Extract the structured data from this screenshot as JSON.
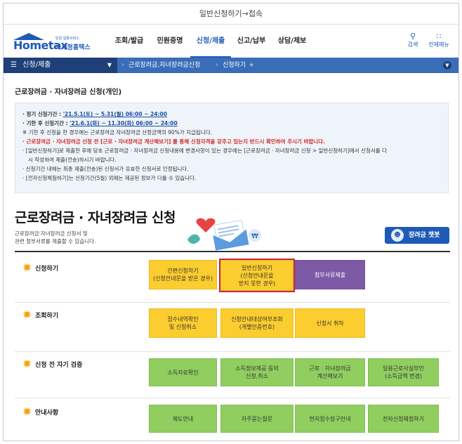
{
  "caption": "일반신청하기→접속",
  "header": {
    "logo_tiny": "민원 일괄서비스",
    "logo_brand": "Hometax",
    "logo_sub": "국세청홈택스",
    "gnb": [
      "조회/발급",
      "민원증명",
      "신청/제출",
      "신고/납부",
      "상담/제보"
    ],
    "active_index": 2,
    "util_search": "검색",
    "util_menu": "전체메뉴"
  },
  "navbar": {
    "menu": "신청/제출",
    "crumb1": "근로장려금,자녀장려금신청",
    "crumb2": "신청하기"
  },
  "page_title": "근로장려금 · 자녀장려금 신청(개인)",
  "notice": {
    "l1_label": "· 정기 신청기간 : ",
    "l1_value": "'21.5.1(토) ~ 5.31(월) 06:00 ~ 24:00",
    "l2_label": "· 기한 후 신청기간 : ",
    "l2_value": "'21.6.1(화) ~ 11.30(화) 06:00 ~ 24:00",
    "l3": "※ 기한 후 신청을 한 경우에는 근로장려금 자녀장려금 산정금액의 90%가 지급됩니다.",
    "l4": "· 근로장려금 · 자녀장려금 신청 전 [근로 · 자녀장려금 계산해보기] 를 통해 신청자격을 갖추고 있는지 반드시 확인하여 주시기 바랍니다.",
    "l5a": "· [일반신청하기]로 제출한 후에 당초 근로장려금 · 자녀장려금 신청내용에 변경사항이 있는 경우에는 [근로장려금 · 자녀장려금 신청 > 일반신청하기]에서 신청서를 다",
    "l5b": "시 작성하여 제출(전송)하시기 바랍니다.",
    "l6": "· 신청기간 내에는 최종 제출(전송)된 신청서가 유효한 신청서로 인정됩니다.",
    "l7": "· [전자신청체험하기]는 신청기간(5월) 외에는 제공된 정보가 다를 수 있습니다."
  },
  "big_title": "근로장려금 · 자녀장려금 신청",
  "desc_1": "근로장려금·자녀장려금 신청서 및",
  "desc_2": "관련 첨부서류를 제출할 수 있습니다.",
  "chatbot_label": "장려금 챗봇",
  "sections": [
    {
      "label": "신청하기",
      "buttons": [
        {
          "l1": "간편신청하기",
          "l2": "(신청안내문을 받은 경우)"
        },
        {
          "l1": "일반신청하기",
          "l2": "(신청안내문을",
          "l3": "받지 못한 경우)"
        },
        {
          "l1": "첨부서류제출"
        }
      ]
    },
    {
      "label": "조회하기",
      "buttons": [
        {
          "l1": "접수내역확인",
          "l2": "및 신청취소"
        },
        {
          "l1": "신청안내대상여부조회",
          "l2": "(개별인증번호)"
        },
        {
          "l1": "신청서 취하"
        }
      ]
    },
    {
      "label": "신청 전 자기 검증",
      "buttons": [
        {
          "l1": "소득자료확인"
        },
        {
          "l1": "소득정보제공 동의",
          "l2": "신청,취소"
        },
        {
          "l1": "근로 · 자녀장려금",
          "l2": "계산해보기"
        },
        {
          "l1": "일용근로사실부인",
          "l2": "(소득금액 변경)"
        }
      ]
    },
    {
      "label": "안내사항",
      "buttons": [
        {
          "l1": "제도안내"
        },
        {
          "l1": "자주묻는질문"
        },
        {
          "l1": "현지접수장구안내"
        },
        {
          "l1": "전자신청체험하기"
        }
      ]
    }
  ],
  "colors": {
    "brand": "#1e5bb7",
    "yellow": "#fbcd2e",
    "purple": "#7d5aa6",
    "green": "#8fce5f",
    "selected_outline": "#d0243f"
  }
}
